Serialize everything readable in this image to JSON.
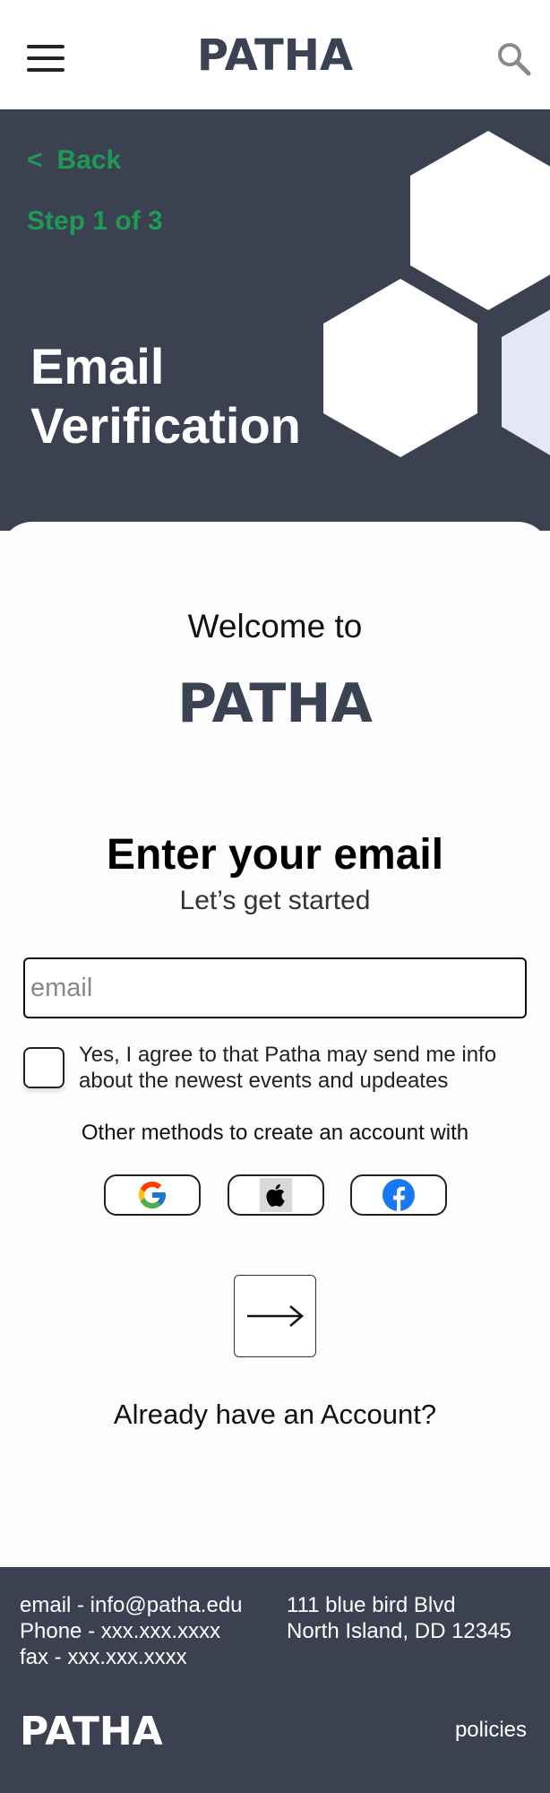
{
  "header": {
    "brand": "PATHA",
    "menu_icon": "hamburger-menu-icon",
    "search_icon": "search-icon"
  },
  "hero": {
    "back_label": "Back",
    "back_chevron": "<",
    "step_label": "Step 1 of 3",
    "title_line1": "Email",
    "title_line2": "Verification",
    "background_color": "#3b4151",
    "accent_color": "#1d9a55"
  },
  "main": {
    "welcome": "Welcome to",
    "brand": "PATHA",
    "heading": "Enter your email",
    "subheading": "Let’s get started",
    "email_placeholder": "email",
    "email_value": "",
    "consent_text": "Yes, I agree to that Patha may send me info about the newest events and updeates",
    "consent_checked": false,
    "other_methods": "Other methods to create an account with",
    "social": [
      {
        "name": "Google",
        "icon": "google-icon"
      },
      {
        "name": "Apple",
        "icon": "apple-icon"
      },
      {
        "name": "Facebook",
        "icon": "facebook-icon"
      }
    ],
    "next_icon": "arrow-right-icon",
    "already_account": "Already have an Account?"
  },
  "footer": {
    "email_line": "email - info@patha.edu",
    "phone_line": "Phone - xxx.xxx.xxxx",
    "fax_line": "fax - xxx.xxx.xxxx",
    "address_line1": "111 blue bird Blvd",
    "address_line2": "North Island, DD 12345",
    "brand": "PATHA",
    "policies": "policies"
  }
}
